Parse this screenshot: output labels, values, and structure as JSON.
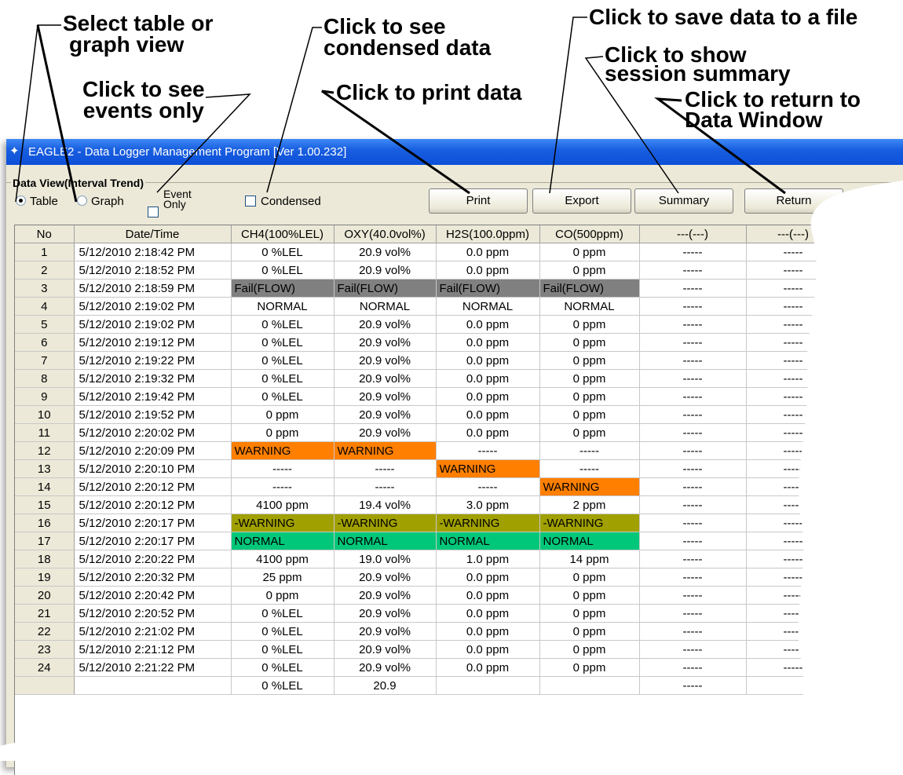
{
  "callouts": {
    "select_view": [
      "Select table or",
      "graph view"
    ],
    "events_only": [
      "Click to see",
      "events only"
    ],
    "condensed": [
      "Click to see",
      "condensed data"
    ],
    "print": [
      "Click to print data"
    ],
    "save": [
      "Click to save data to a file"
    ],
    "summary": [
      "Click to show",
      "session summary"
    ],
    "return": [
      "Click to return to",
      "Data Window"
    ]
  },
  "window": {
    "title": "EAGLE2  - Data Logger Management Program [Ver 1.00.232]",
    "group_label": "Data View(Interval Trend)"
  },
  "options": {
    "table": "Table",
    "graph": "Graph",
    "event_only": [
      "Event",
      "Only"
    ],
    "condensed": "Condensed",
    "selected_view": "Table"
  },
  "buttons": {
    "print": "Print",
    "export": "Export",
    "summary": "Summary",
    "return": "Return"
  },
  "table": {
    "columns": [
      "No",
      "Date/Time",
      "CH4(100%LEL)",
      "OXY(40.0vol%)",
      "H2S(100.0ppm)",
      "CO(500ppm)",
      "---(---)",
      "---(---)"
    ],
    "rows": [
      {
        "no": "1",
        "dt": "5/12/2010 2:18:42 PM",
        "c": [
          "0 %LEL",
          "20.9 vol%",
          "0.0 ppm",
          "0 ppm",
          "-----",
          "-----"
        ],
        "s": [
          "",
          "",
          "",
          "",
          "",
          ""
        ]
      },
      {
        "no": "2",
        "dt": "5/12/2010 2:18:52 PM",
        "c": [
          "0 %LEL",
          "20.9 vol%",
          "0.0 ppm",
          "0 ppm",
          "-----",
          "-----"
        ],
        "s": [
          "",
          "",
          "",
          "",
          "",
          ""
        ]
      },
      {
        "no": "3",
        "dt": "5/12/2010 2:18:59 PM",
        "c": [
          "Fail(FLOW)",
          "Fail(FLOW)",
          "Fail(FLOW)",
          "Fail(FLOW)",
          "-----",
          "-----"
        ],
        "s": [
          "fail",
          "fail",
          "fail",
          "fail",
          "",
          ""
        ]
      },
      {
        "no": "4",
        "dt": "5/12/2010 2:19:02 PM",
        "c": [
          "NORMAL",
          "NORMAL",
          "NORMAL",
          "NORMAL",
          "-----",
          "-----"
        ],
        "s": [
          "",
          "",
          "",
          "",
          "",
          ""
        ]
      },
      {
        "no": "5",
        "dt": "5/12/2010 2:19:02 PM",
        "c": [
          "0 %LEL",
          "20.9 vol%",
          "0.0 ppm",
          "0 ppm",
          "-----",
          "-----"
        ],
        "s": [
          "",
          "",
          "",
          "",
          "",
          ""
        ]
      },
      {
        "no": "6",
        "dt": "5/12/2010 2:19:12 PM",
        "c": [
          "0 %LEL",
          "20.9 vol%",
          "0.0 ppm",
          "0 ppm",
          "-----",
          "-----"
        ],
        "s": [
          "",
          "",
          "",
          "",
          "",
          ""
        ]
      },
      {
        "no": "7",
        "dt": "5/12/2010 2:19:22 PM",
        "c": [
          "0 %LEL",
          "20.9 vol%",
          "0.0 ppm",
          "0 ppm",
          "-----",
          "-----"
        ],
        "s": [
          "",
          "",
          "",
          "",
          "",
          ""
        ]
      },
      {
        "no": "8",
        "dt": "5/12/2010 2:19:32 PM",
        "c": [
          "0 %LEL",
          "20.9 vol%",
          "0.0 ppm",
          "0 ppm",
          "-----",
          "-----"
        ],
        "s": [
          "",
          "",
          "",
          "",
          "",
          ""
        ]
      },
      {
        "no": "9",
        "dt": "5/12/2010 2:19:42 PM",
        "c": [
          "0 %LEL",
          "20.9 vol%",
          "0.0 ppm",
          "0 ppm",
          "-----",
          "-----"
        ],
        "s": [
          "",
          "",
          "",
          "",
          "",
          ""
        ]
      },
      {
        "no": "10",
        "dt": "5/12/2010 2:19:52 PM",
        "c": [
          "0 ppm",
          "20.9 vol%",
          "0.0 ppm",
          "0 ppm",
          "-----",
          "-----"
        ],
        "s": [
          "",
          "",
          "",
          "",
          "",
          ""
        ]
      },
      {
        "no": "11",
        "dt": "5/12/2010 2:20:02 PM",
        "c": [
          "0 ppm",
          "20.9 vol%",
          "0.0 ppm",
          "0 ppm",
          "-----",
          "-----"
        ],
        "s": [
          "",
          "",
          "",
          "",
          "",
          ""
        ]
      },
      {
        "no": "12",
        "dt": "5/12/2010 2:20:09 PM",
        "c": [
          "WARNING",
          "WARNING",
          "-----",
          "-----",
          "-----",
          "-----"
        ],
        "s": [
          "warn",
          "warn",
          "",
          "",
          "",
          ""
        ]
      },
      {
        "no": "13",
        "dt": "5/12/2010 2:20:10 PM",
        "c": [
          "-----",
          "-----",
          "WARNING",
          "-----",
          "-----",
          "-----"
        ],
        "s": [
          "",
          "",
          "warn",
          "",
          "",
          ""
        ]
      },
      {
        "no": "14",
        "dt": "5/12/2010 2:20:12 PM",
        "c": [
          "-----",
          "-----",
          "-----",
          "WARNING",
          "-----",
          "-----"
        ],
        "s": [
          "",
          "",
          "",
          "warn",
          "",
          ""
        ]
      },
      {
        "no": "15",
        "dt": "5/12/2010 2:20:12 PM",
        "c": [
          "4100 ppm",
          "19.4 vol%",
          "3.0 ppm",
          "2 ppm",
          "-----",
          "-----"
        ],
        "s": [
          "",
          "",
          "",
          "",
          "",
          ""
        ]
      },
      {
        "no": "16",
        "dt": "5/12/2010 2:20:17 PM",
        "c": [
          "-WARNING",
          "-WARNING",
          "-WARNING",
          "-WARNING",
          "-----",
          "-----"
        ],
        "s": [
          "nwarn",
          "nwarn",
          "nwarn",
          "nwarn",
          "",
          ""
        ]
      },
      {
        "no": "17",
        "dt": "5/12/2010 2:20:17 PM",
        "c": [
          "NORMAL",
          "NORMAL",
          "NORMAL",
          "NORMAL",
          "-----",
          "-----"
        ],
        "s": [
          "norm",
          "norm",
          "norm",
          "norm",
          "",
          ""
        ]
      },
      {
        "no": "18",
        "dt": "5/12/2010 2:20:22 PM",
        "c": [
          "4100 ppm",
          "19.0 vol%",
          "1.0 ppm",
          "14 ppm",
          "-----",
          "-----"
        ],
        "s": [
          "",
          "",
          "",
          "",
          "",
          ""
        ]
      },
      {
        "no": "19",
        "dt": "5/12/2010 2:20:32 PM",
        "c": [
          "25 ppm",
          "20.9 vol%",
          "0.0 ppm",
          "0 ppm",
          "-----",
          "-----"
        ],
        "s": [
          "",
          "",
          "",
          "",
          "",
          ""
        ]
      },
      {
        "no": "20",
        "dt": "5/12/2010 2:20:42 PM",
        "c": [
          "0 ppm",
          "20.9 vol%",
          "0.0 ppm",
          "0 ppm",
          "-----",
          "-----"
        ],
        "s": [
          "",
          "",
          "",
          "",
          "",
          ""
        ]
      },
      {
        "no": "21",
        "dt": "5/12/2010 2:20:52 PM",
        "c": [
          "0 %LEL",
          "20.9 vol%",
          "0.0 ppm",
          "0 ppm",
          "-----",
          "-----"
        ],
        "s": [
          "",
          "",
          "",
          "",
          "",
          ""
        ]
      },
      {
        "no": "22",
        "dt": "5/12/2010 2:21:02 PM",
        "c": [
          "0 %LEL",
          "20.9 vol%",
          "0.0 ppm",
          "0 ppm",
          "-----",
          "-----"
        ],
        "s": [
          "",
          "",
          "",
          "",
          "",
          ""
        ]
      },
      {
        "no": "23",
        "dt": "5/12/2010 2:21:12 PM",
        "c": [
          "0 %LEL",
          "20.9 vol%",
          "0.0 ppm",
          "0 ppm",
          "-----",
          "-----"
        ],
        "s": [
          "",
          "",
          "",
          "",
          "",
          ""
        ]
      },
      {
        "no": "24",
        "dt": "5/12/2010 2:21:22 PM",
        "c": [
          "0 %LEL",
          "20.9 vol%",
          "0.0 ppm",
          "0 ppm",
          "-----",
          "-----"
        ],
        "s": [
          "",
          "",
          "",
          "",
          "",
          ""
        ]
      },
      {
        "no": "",
        "dt": "",
        "c": [
          "0 %LEL",
          "20.9",
          "",
          "",
          "-----",
          ""
        ],
        "s": [
          "",
          "",
          "",
          "",
          "",
          ""
        ]
      }
    ]
  },
  "colors": {
    "warning": "#ff7f00",
    "fail": "#808080",
    "neg_warning": "#a0a000",
    "normal": "#00c77a",
    "titlebar": "#0a4fd8"
  }
}
